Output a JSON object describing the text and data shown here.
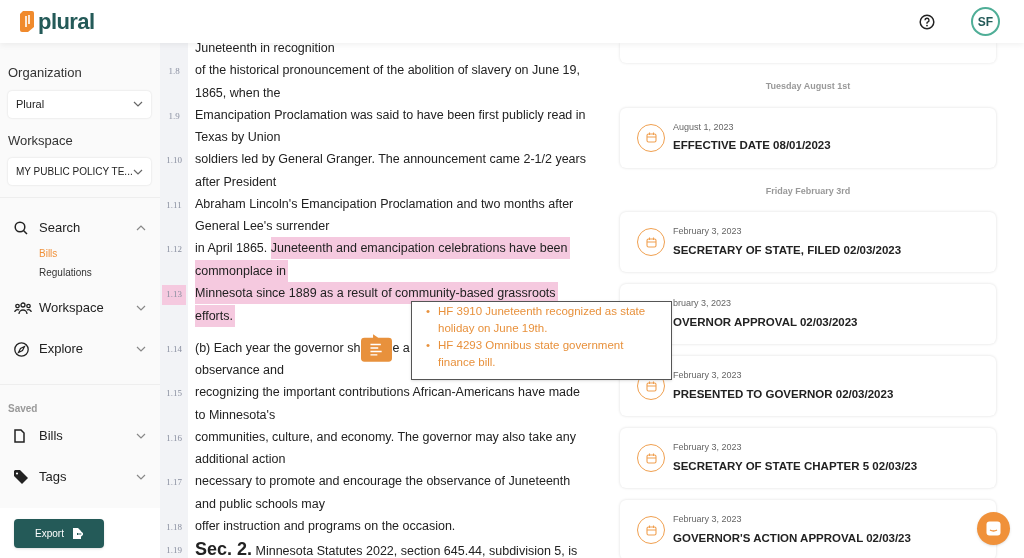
{
  "header": {
    "logo": "plural",
    "avatar": "SF"
  },
  "sidebar": {
    "organization_label": "Organization",
    "organization": "Plural",
    "workspace_label": "Workspace",
    "workspace": "MY PUBLIC POLICY TE...",
    "nav": [
      {
        "label": "Search",
        "expanded": true,
        "children": [
          {
            "label": "Bills",
            "selected": true
          },
          {
            "label": "Regulations",
            "selected": false
          }
        ]
      },
      {
        "label": "Workspace",
        "expanded": false
      },
      {
        "label": "Explore",
        "expanded": false
      }
    ],
    "saved_label": "Saved",
    "saved": [
      {
        "label": "Bills",
        "expanded": false
      },
      {
        "label": "Tags",
        "expanded": false
      }
    ],
    "export_button": "Export"
  },
  "document": {
    "rows": [
      {
        "plain": "Juneteenth in recognition"
      },
      {
        "number": "1.8",
        "plain": "of the historical pronouncement of the abolition of slavery on June 19,"
      },
      {
        "plain": "1865, when the"
      },
      {
        "number": "1.9",
        "plain": "Emancipation Proclamation was said to have been first publicly read in"
      },
      {
        "plain": "Texas by Union"
      },
      {
        "number": "1.10",
        "plain": "soldiers led by General Granger. The announcement came 2-1/2 years"
      },
      {
        "plain": "after President"
      },
      {
        "number": "1.11",
        "plain": "Abraham Lincoln's Emancipation Proclamation and two months after"
      },
      {
        "plain": "General Lee's surrender"
      },
      {
        "number": "1.12",
        "plain": "in April 1865. ",
        "marked": "Juneteenth and emancipation celebrations have been"
      },
      {
        "marked": "commonplace in"
      },
      {
        "number": "1.13",
        "number_marked": true,
        "marked": "Minnesota since 1889 as a result of community-based grassroots"
      },
      {
        "marked": "efforts.",
        "paragraph_end": true
      },
      {
        "number": "1.14",
        "plain": "(b) Each year the governor sh",
        "comment": true,
        "after": "e a"
      },
      {
        "plain": "observance and"
      },
      {
        "number": "1.15",
        "plain": "recognizing the important contributions African-Americans have made"
      },
      {
        "plain": "to Minnesota's"
      },
      {
        "number": "1.16",
        "plain": "communities, culture, and economy. The governor may also take any"
      },
      {
        "plain": "additional action"
      },
      {
        "number": "1.17",
        "plain": "necessary to promote and encourage the observance of Juneteenth"
      },
      {
        "plain": "and public schools may"
      },
      {
        "number": "1.18",
        "plain": "offer instruction and programs on the occasion."
      },
      {
        "number": "1.19",
        "heading": "Sec. 2.",
        "plain": " Minnesota Statutes 2022, section 645.44, subdivision 5, is"
      }
    ],
    "tooltip": [
      {
        "bullet": "•",
        "text": "HF 3910 Juneteenth recognized as state holiday on June 19th."
      },
      {
        "bullet": "•",
        "text": "HF 4293 Omnibus state government finance bill."
      }
    ]
  },
  "timeline": [
    {
      "kind": "heading",
      "label": "Tuesday August 1st"
    },
    {
      "kind": "event",
      "date": "August 1, 2023",
      "title": "EFFECTIVE DATE 08/01/2023"
    },
    {
      "kind": "heading",
      "label": "Friday February 3rd"
    },
    {
      "kind": "event",
      "date": "February 3, 2023",
      "title": "SECRETARY OF STATE, FILED 02/03/2023"
    },
    {
      "kind": "covered_event",
      "date": "bruary 3, 2023",
      "title": "OVERNOR APPROVAL 02/03/2023"
    },
    {
      "kind": "event",
      "date": "February 3, 2023",
      "title": "PRESENTED TO GOVERNOR 02/03/2023"
    },
    {
      "kind": "event",
      "date": "February 3, 2023",
      "title": "SECRETARY OF STATE CHAPTER 5 02/03/23"
    },
    {
      "kind": "event",
      "date": "February 3, 2023",
      "title": "GOVERNOR'S ACTION APPROVAL 02/03/23"
    }
  ]
}
